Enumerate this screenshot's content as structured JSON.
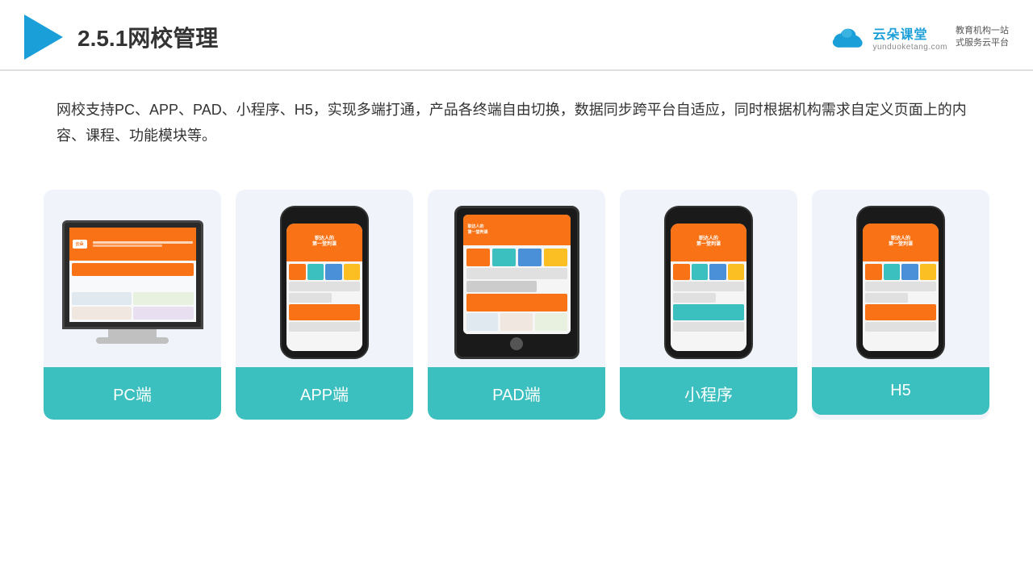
{
  "header": {
    "title": "2.5.1网校管理",
    "brand": {
      "name": "云朵课堂",
      "url": "yunduoketang.com",
      "slogan": "教育机构一站\n式服务云平台"
    }
  },
  "description": {
    "text": "网校支持PC、APP、PAD、小程序、H5，实现多端打通，产品各终端自由切换，数据同步跨平台自适应，同时根据机构需求自定义页面上的内容、课程、功能模块等。"
  },
  "cards": [
    {
      "id": "pc",
      "label": "PC端"
    },
    {
      "id": "app",
      "label": "APP端"
    },
    {
      "id": "pad",
      "label": "PAD端"
    },
    {
      "id": "miniapp",
      "label": "小程序"
    },
    {
      "id": "h5",
      "label": "H5"
    }
  ],
  "colors": {
    "accent": "#3bbfbf",
    "orange": "#f97316",
    "blue": "#1a9fd8",
    "card_bg": "#eef2f8"
  }
}
